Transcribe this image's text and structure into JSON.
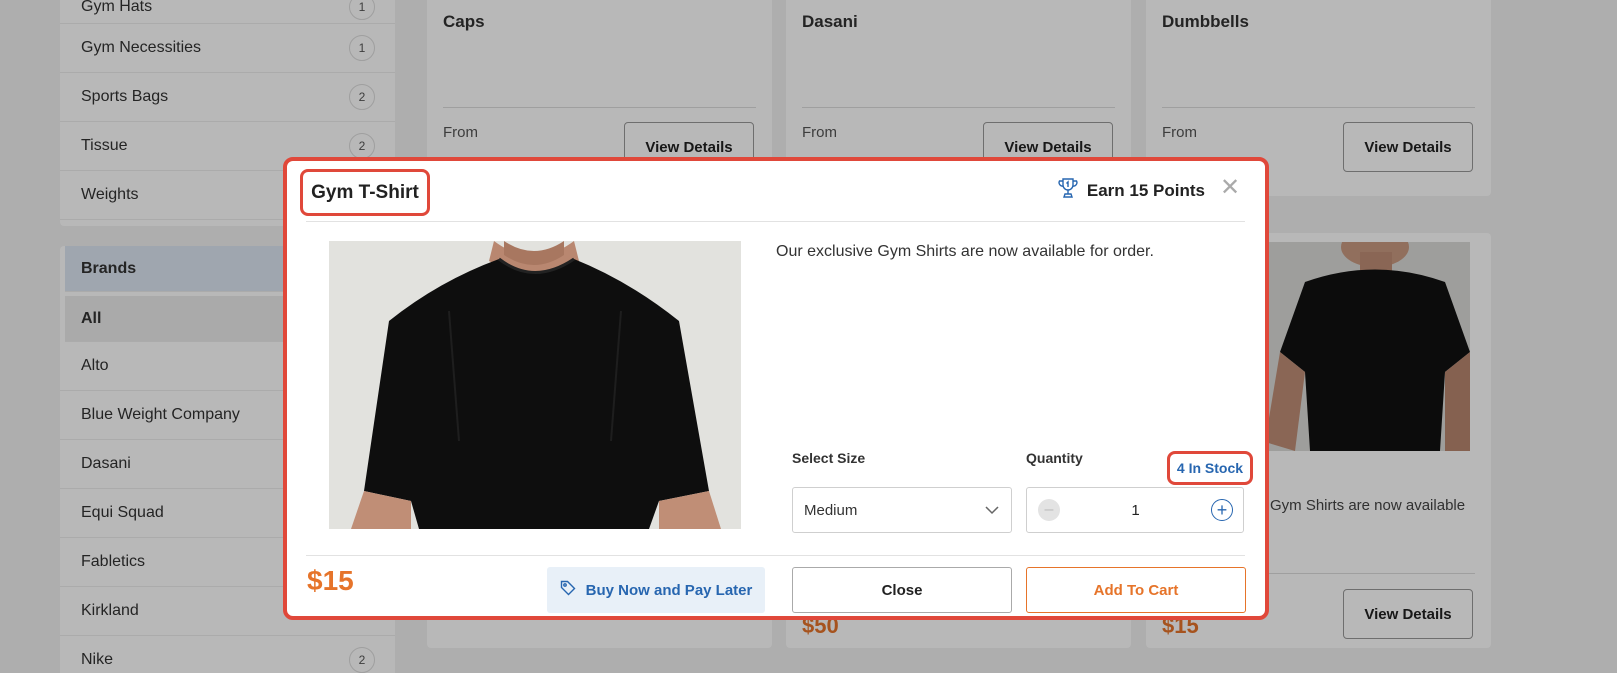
{
  "categories": [
    {
      "label": "Gym Hats",
      "count": "1"
    },
    {
      "label": "Gym Necessities",
      "count": "1"
    },
    {
      "label": "Sports Bags",
      "count": "2"
    },
    {
      "label": "Tissue",
      "count": "2"
    },
    {
      "label": "Weights",
      "count": ""
    }
  ],
  "brands": {
    "heading": "Brands",
    "all_label": "All",
    "items": [
      {
        "label": "Alto",
        "count": ""
      },
      {
        "label": "Blue Weight Company",
        "count": ""
      },
      {
        "label": "Dasani",
        "count": ""
      },
      {
        "label": "Equi Squad",
        "count": ""
      },
      {
        "label": "Fabletics",
        "count": ""
      },
      {
        "label": "Kirkland",
        "count": ""
      },
      {
        "label": "Nike",
        "count": "2"
      }
    ]
  },
  "products": [
    {
      "name": "Caps",
      "from_label": "From",
      "button": "View Details"
    },
    {
      "name": "Dasani",
      "from_label": "From",
      "button": "View Details"
    },
    {
      "name": "Dumbbells",
      "from_label": "From",
      "button": "View Details"
    }
  ],
  "lower_row": {
    "price_mid": "$50",
    "price_right": "$15",
    "button_right": "View Details",
    "desc_right": "Gym Shirts are now available"
  },
  "modal": {
    "title": "Gym T-Shirt",
    "points": "Earn 15 Points",
    "close_glyph": "✕",
    "description": "Our exclusive Gym Shirts are now available for order.",
    "size_label": "Select Size",
    "size_value": "Medium",
    "quantity_label": "Quantity",
    "stock": "4 In Stock",
    "quantity_value": "1",
    "price": "$15",
    "bnpl_label": "Buy Now and Pay Later",
    "close_button": "Close",
    "add_button": "Add To Cart"
  },
  "colors": {
    "accent_orange": "#e6742a",
    "link_blue": "#2766b0",
    "highlight_red": "#e0483a"
  }
}
